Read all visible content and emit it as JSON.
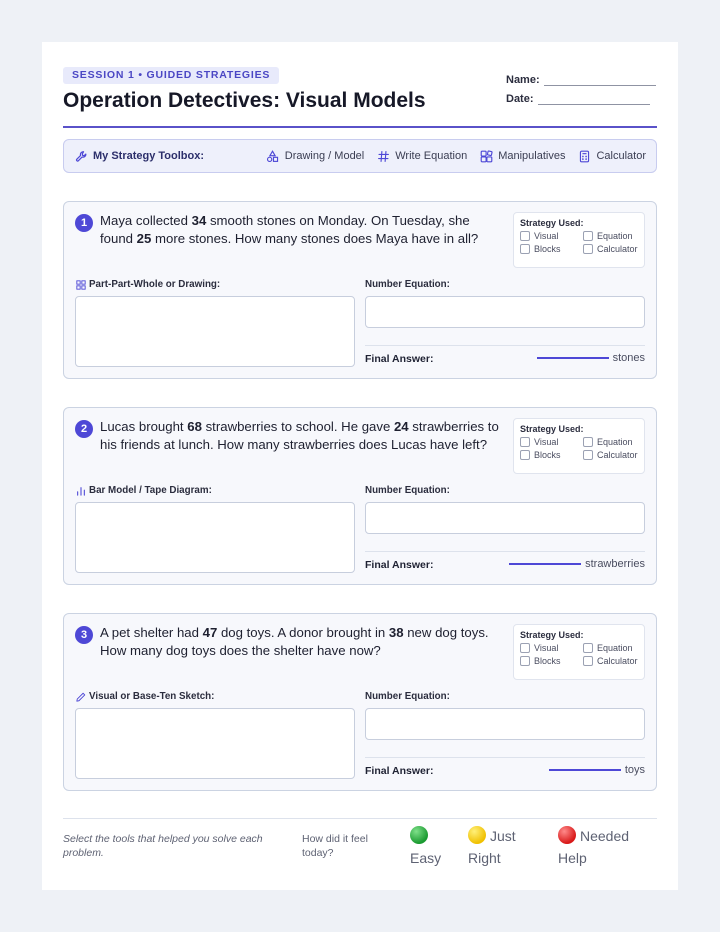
{
  "header": {
    "session_badge": "SESSION 1 • GUIDED STRATEGIES",
    "title": "Operation Detectives: Visual Models",
    "name_label": "Name:",
    "date_label": "Date:"
  },
  "toolbox": {
    "title": "My Strategy Toolbox:",
    "items": [
      {
        "label": "Drawing / Model",
        "icon": "shapes-icon"
      },
      {
        "label": "Write Equation",
        "icon": "hash-icon"
      },
      {
        "label": "Manipulatives",
        "icon": "blocks-icon"
      },
      {
        "label": "Calculator",
        "icon": "calculator-icon"
      }
    ]
  },
  "strategy": {
    "title": "Strategy Used:",
    "options": [
      "Visual",
      "Equation",
      "Blocks",
      "Calculator"
    ]
  },
  "problems": [
    {
      "number": "1",
      "text_parts": [
        "Maya collected ",
        "34",
        " smooth stones on Monday. On Tuesday, she found ",
        "25",
        " more stones. How many stones does Maya have in all?"
      ],
      "drawing_label": "Part-Part-Whole or Drawing:",
      "drawing_icon": "grid-icon",
      "equation_label": "Number Equation:",
      "final_label": "Final Answer:",
      "unit": "stones"
    },
    {
      "number": "2",
      "text_parts": [
        "Lucas brought ",
        "68",
        " strawberries to school. He gave ",
        "24",
        " strawberries to his friends at lunch. How many strawberries does Lucas have left?"
      ],
      "drawing_label": "Bar Model / Tape Diagram:",
      "drawing_icon": "bar-chart-icon",
      "equation_label": "Number Equation:",
      "final_label": "Final Answer:",
      "unit": "strawberries"
    },
    {
      "number": "3",
      "text_parts": [
        "A pet shelter had ",
        "47",
        " dog toys. A donor brought in ",
        "38",
        " new dog toys. How many dog toys does the shelter have now?"
      ],
      "drawing_label": "Visual or Base-Ten Sketch:",
      "drawing_icon": "pencil-icon",
      "equation_label": "Number Equation:",
      "final_label": "Final Answer:",
      "unit": "toys"
    }
  ],
  "footer": {
    "note": "Select the tools that helped you solve each problem.",
    "feel_prompt": "How did it feel today?",
    "ratings": [
      {
        "label": "Easy",
        "color": "#22a83a"
      },
      {
        "label": "Just Right",
        "color": "#f5c800"
      },
      {
        "label": "Needed Help",
        "color": "#e02020"
      }
    ]
  },
  "colors": {
    "accent": "#4e48d6",
    "badge_bg": "#e8eafb",
    "toolbox_bg": "#eef0fb"
  }
}
